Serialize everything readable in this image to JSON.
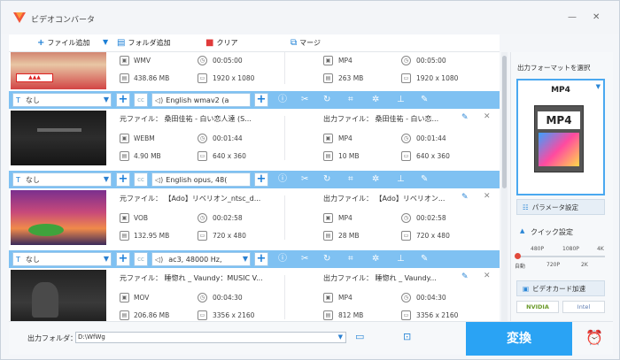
{
  "app": {
    "title": "ビデオコンバータ",
    "minimize": "—",
    "close": "✕"
  },
  "toolbar": {
    "add_file": "ファイル追加",
    "add_folder": "フォルダ追加",
    "clear": "クリア",
    "merge": "マージ"
  },
  "items": [
    {
      "src_format": "WMV",
      "src_duration": "00:05:00",
      "src_size": "438.86 MB",
      "src_res": "1920 x 1080",
      "out_format": "MP4",
      "out_duration": "00:05:00",
      "out_size": "263 MB",
      "out_res": "1920 x 1080",
      "bar": {
        "subtitle": "なし",
        "audio": "English wmav2 (a"
      }
    },
    {
      "src_name": "元ファイル： 桑田佳祐 - 白い恋人達 (S...",
      "out_name": "出力ファイル： 桑田佳祐 - 白い恋...",
      "src_format": "WEBM",
      "src_duration": "00:01:44",
      "src_size": "4.90 MB",
      "src_res": "640 x 360",
      "out_format": "MP4",
      "out_duration": "00:01:44",
      "out_size": "10 MB",
      "out_res": "640 x 360",
      "bar": {
        "subtitle": "なし",
        "audio": "English opus, 48("
      }
    },
    {
      "src_name": "元ファイル： 【Ado】リベリオン_ntsc_d...",
      "out_name": "出力ファイル： 【Ado】リベリオン...",
      "src_format": "VOB",
      "src_duration": "00:02:58",
      "src_size": "132.95 MB",
      "src_res": "720 x 480",
      "out_format": "MP4",
      "out_duration": "00:02:58",
      "out_size": "28 MB",
      "out_res": "720 x 480",
      "bar": {
        "subtitle": "なし",
        "audio": "ac3, 48000 Hz,"
      }
    },
    {
      "src_name": "元ファイル： 睡惚れ _ Vaundy：MUSIC V...",
      "out_name": "出力ファイル： 睡惚れ _ Vaundy...",
      "src_format": "MOV",
      "src_duration": "00:04:30",
      "src_size": "206.86 MB",
      "src_res": "3356 x 2160",
      "out_format": "MP4",
      "out_duration": "00:04:30",
      "out_size": "812 MB",
      "out_res": "3356 x 2160"
    }
  ],
  "panel": {
    "output_format_label": "出力フォーマットを選択",
    "format": "MP4",
    "format_badge": "MP4",
    "param_button": "パラメータ設定",
    "quick_label": "クイック設定",
    "ticks_top": [
      "480P",
      "1080P",
      "4K"
    ],
    "ticks_bottom": [
      "自動",
      "720P",
      "2K"
    ],
    "gpu_button": "ビデオカード加速",
    "nvidia": "NVIDIA",
    "intel": "Intel"
  },
  "bottom": {
    "folder_label": "出力フォルダ：",
    "folder_path": "D:\\WfWg",
    "convert": "変換"
  },
  "colors": {
    "accent": "#2aa3f4",
    "bar": "#7fc1f2"
  }
}
